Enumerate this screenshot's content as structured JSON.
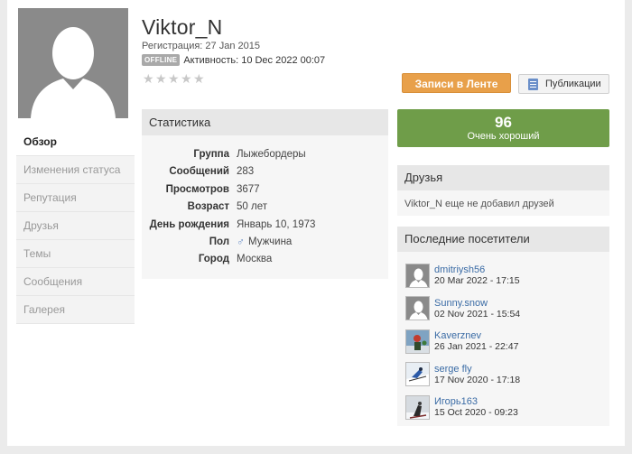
{
  "profile": {
    "username": "Viktor_N",
    "registration": "Регистрация: 27 Jan 2015",
    "status_badge": "OFFLINE",
    "activity": "Активность: 10 Dec 2022 00:07",
    "rating_stars_filled": 0,
    "rating_stars_total": 5
  },
  "nav": {
    "items": [
      {
        "label": "Обзор"
      },
      {
        "label": "Изменения статуса"
      },
      {
        "label": "Репутация"
      },
      {
        "label": "Друзья"
      },
      {
        "label": "Темы"
      },
      {
        "label": "Сообщения"
      },
      {
        "label": "Галерея"
      }
    ]
  },
  "buttons": {
    "feed": "Записи в Ленте",
    "publications": "Публикации"
  },
  "stats": {
    "title": "Статистика",
    "rows": [
      {
        "key": "Группа",
        "value": "Лыжебордеры"
      },
      {
        "key": "Сообщений",
        "value": "283"
      },
      {
        "key": "Просмотров",
        "value": "3677"
      },
      {
        "key": "Возраст",
        "value": "50 лет"
      },
      {
        "key": "День рождения",
        "value": "Январь 10, 1973"
      },
      {
        "key": "Пол",
        "value": "Мужчина"
      },
      {
        "key": "Город",
        "value": "Москва"
      }
    ]
  },
  "reputation": {
    "score": "96",
    "label": "Очень хороший",
    "color": "#6f9d49"
  },
  "friends": {
    "title": "Друзья",
    "empty_text": "Viktor_N еще не добавил друзей"
  },
  "visitors": {
    "title": "Последние посетители",
    "items": [
      {
        "name": "dmitriysh56",
        "date": "20 Mar 2022 - 17:15"
      },
      {
        "name": "Sunny.snow",
        "date": "02 Nov 2021 - 15:54"
      },
      {
        "name": "Kaverznev",
        "date": "26 Jan 2021 - 22:47"
      },
      {
        "name": "serge fly",
        "date": "17 Nov 2020 - 17:18"
      },
      {
        "name": "Игорь163",
        "date": "15 Oct 2020 - 09:23"
      }
    ]
  }
}
